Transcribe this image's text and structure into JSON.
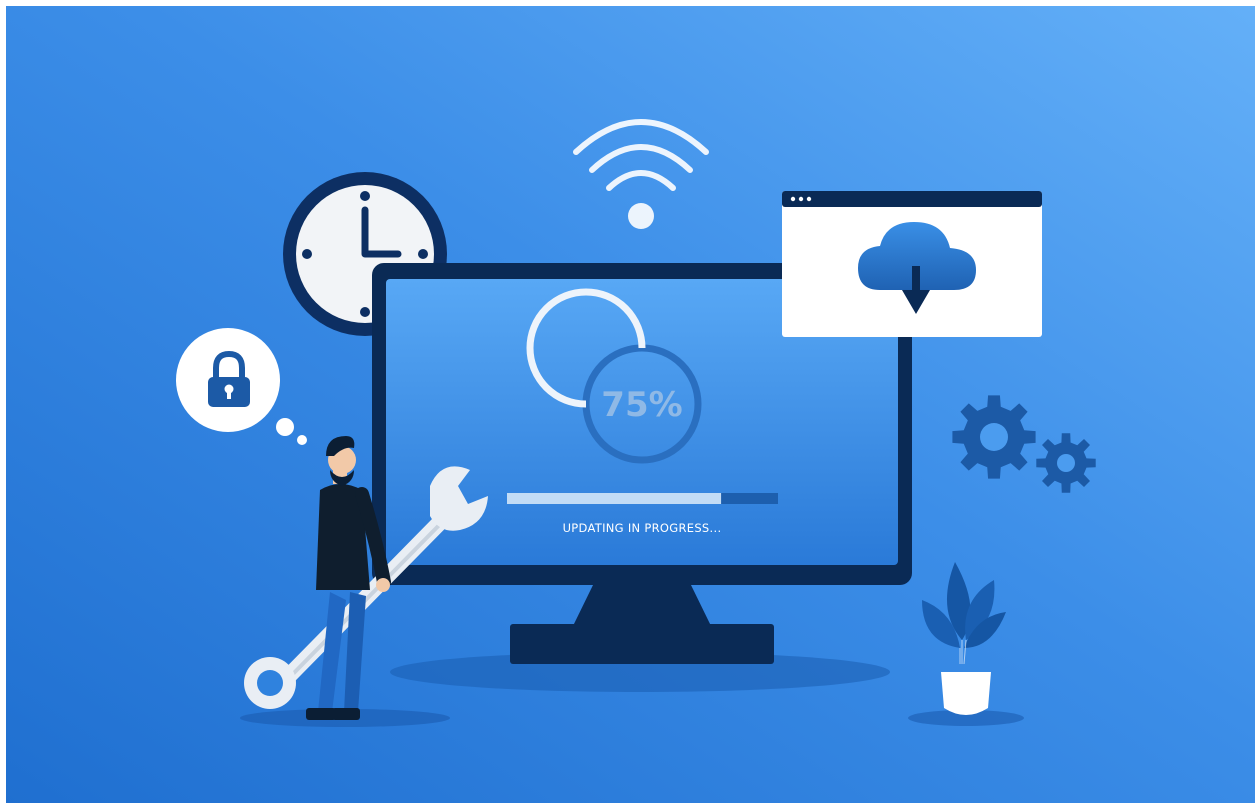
{
  "progress": {
    "percent_label": "75%",
    "fraction": 0.75,
    "bar_fraction": 0.79,
    "status_label": "UPDATING IN PROGRESS..."
  },
  "icons": {
    "clock": "clock-icon",
    "wifi": "wifi-icon",
    "lock": "padlock-icon",
    "cloud": "cloud-download-icon",
    "gears": "gear-icon",
    "wrench": "wrench-icon",
    "plant": "potted-plant-icon"
  },
  "colors": {
    "bg_left": "#2a78d6",
    "bg_right": "#5eacf7",
    "navy": "#0b2d5c",
    "screen": "#3d92e8",
    "accent_blue": "#1f5fa8",
    "white": "#ffffff"
  }
}
